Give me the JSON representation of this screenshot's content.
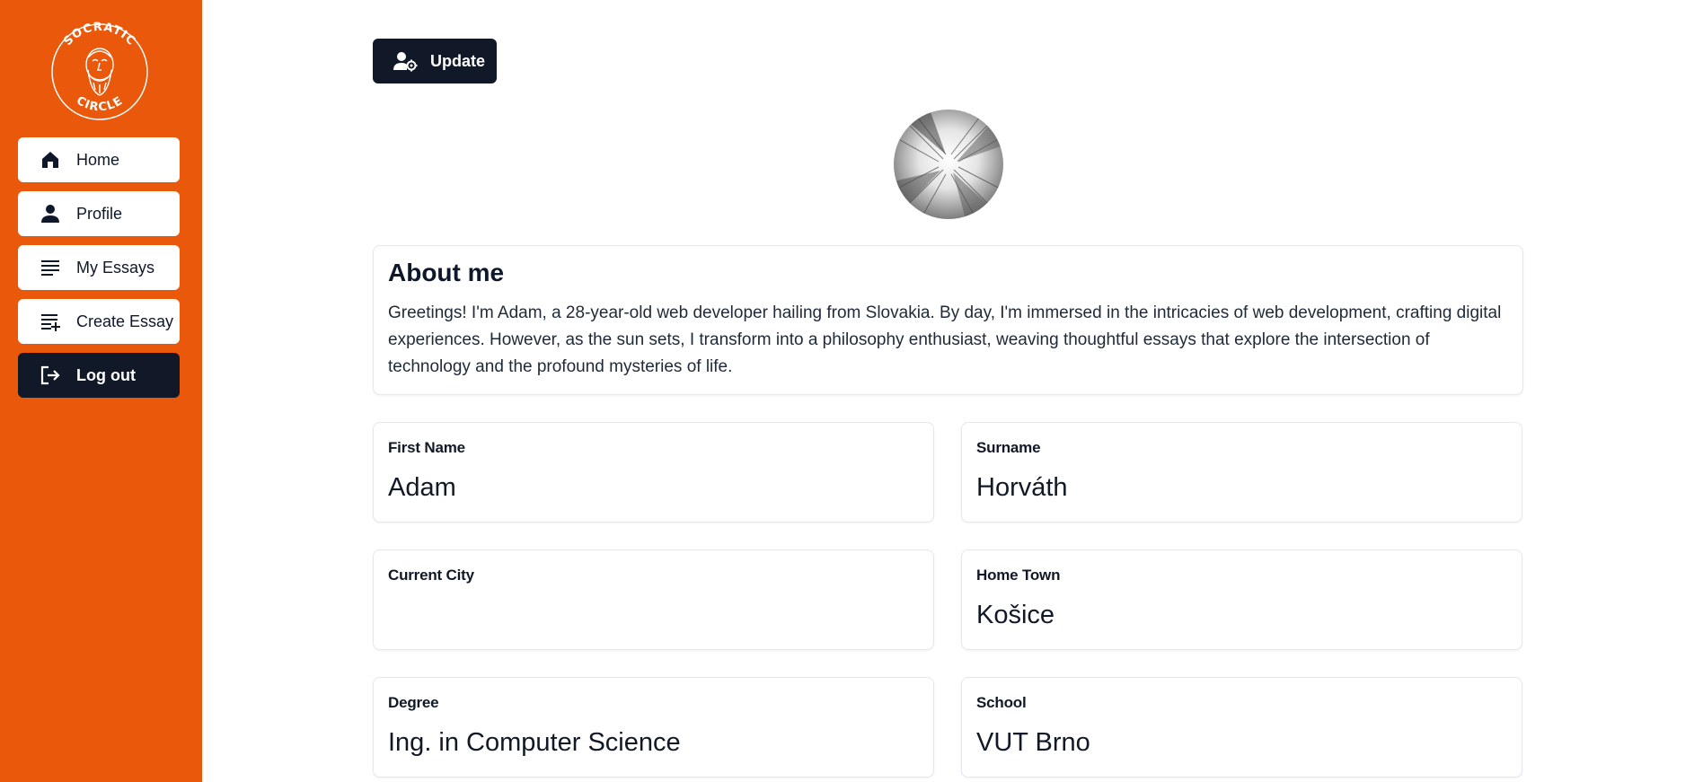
{
  "logo": {
    "top_text": "SOCRATIC",
    "bottom_text": "CIRCLE"
  },
  "sidebar": {
    "items": [
      {
        "label": "Home",
        "icon": "home-icon"
      },
      {
        "label": "Profile",
        "icon": "person-icon"
      },
      {
        "label": "My Essays",
        "icon": "list-icon"
      },
      {
        "label": "Create Essay",
        "icon": "playlist-add-icon"
      },
      {
        "label": "Log out",
        "icon": "logout-icon"
      }
    ]
  },
  "toolbar": {
    "update_label": "Update"
  },
  "about": {
    "heading": "About me",
    "text": "Greetings! I'm Adam, a 28-year-old web developer hailing from Slovakia. By day, I'm immersed in the intricacies of web development, crafting digital experiences. However, as the sun sets, I transform into a philosophy enthusiast, weaving thoughtful essays that explore the intersection of technology and the profound mysteries of life."
  },
  "fields": {
    "first_name": {
      "label": "First Name",
      "value": "Adam"
    },
    "surname": {
      "label": "Surname",
      "value": "Horváth"
    },
    "current_city": {
      "label": "Current City",
      "value": ""
    },
    "home_town": {
      "label": "Home Town",
      "value": "Košice"
    },
    "degree": {
      "label": "Degree",
      "value": "Ing. in Computer Science"
    },
    "school": {
      "label": "School",
      "value": "VUT Brno"
    }
  },
  "colors": {
    "sidebar": "#ea580c",
    "dark": "#111827",
    "card_border": "#e5e7eb"
  }
}
